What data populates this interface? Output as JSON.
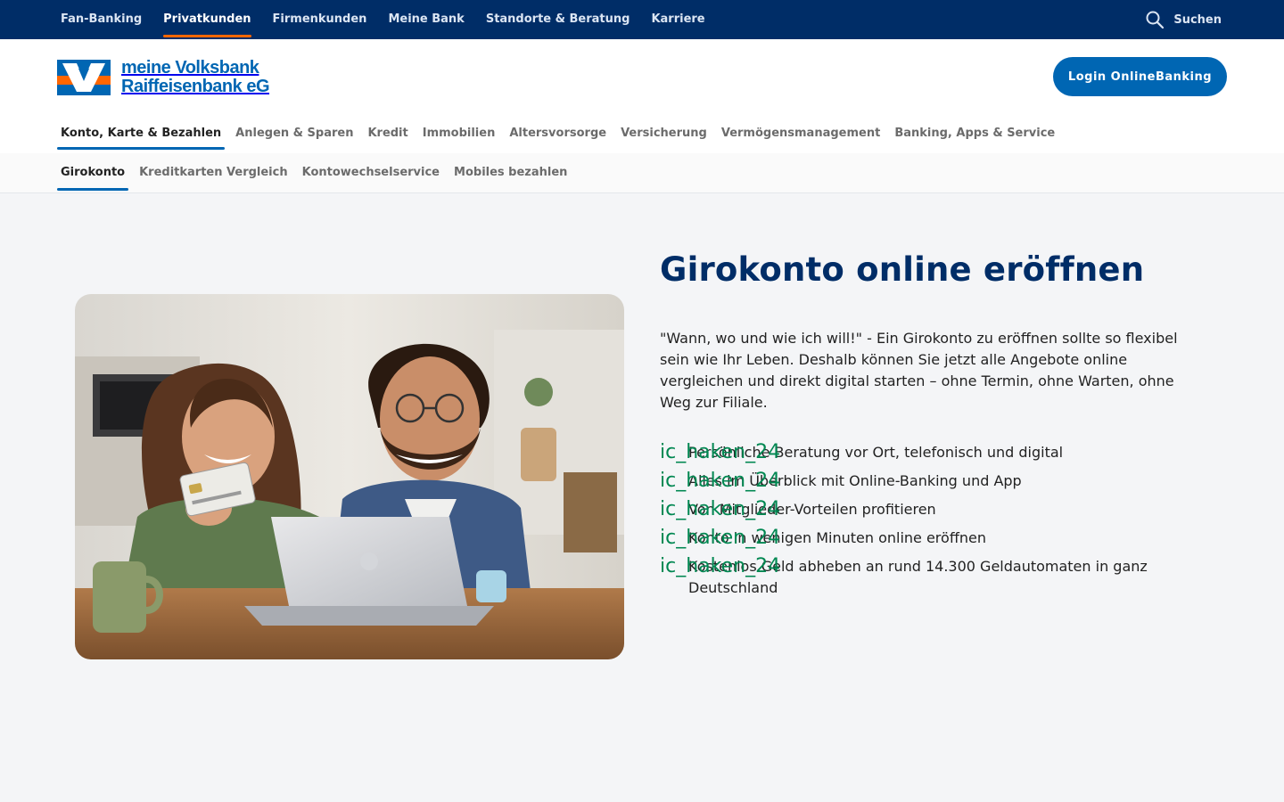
{
  "topbar": {
    "items": [
      {
        "label": "Fan-Banking"
      },
      {
        "label": "Privatkunden"
      },
      {
        "label": "Firmenkunden"
      },
      {
        "label": "Meine Bank"
      },
      {
        "label": "Standorte & Beratung"
      },
      {
        "label": "Karriere"
      }
    ],
    "active_item": "Privatkunden",
    "search_label": "Suchen"
  },
  "header": {
    "logo_line1": "meine Volksbank",
    "logo_line2": "Raiffeisenbank eG",
    "login_label": "Login OnlineBanking"
  },
  "mainnav": {
    "items": [
      {
        "label": "Konto, Karte & Bezahlen"
      },
      {
        "label": "Anlegen & Sparen"
      },
      {
        "label": "Kredit"
      },
      {
        "label": "Immobilien"
      },
      {
        "label": "Altersvorsorge"
      },
      {
        "label": "Versicherung"
      },
      {
        "label": "Vermögensmanagement"
      },
      {
        "label": "Banking, Apps & Service"
      }
    ],
    "active_item": "Konto, Karte & Bezahlen"
  },
  "subnav": {
    "items": [
      {
        "label": "Girokonto"
      },
      {
        "label": "Kreditkarten Vergleich"
      },
      {
        "label": "Kontowechselservice"
      },
      {
        "label": "Mobiles bezahlen"
      }
    ],
    "active_item": "Girokonto"
  },
  "hero": {
    "title": "Girokonto online eröffnen",
    "intro": "\"Wann, wo und wie ich will!\" - Ein Girokonto zu eröffnen sollte so flexibel sein wie Ihr Leben. Deshalb können Sie jetzt alle Angebote online vergleichen und direkt digital starten – ohne Termin, ohne Warten, ohne Weg zur Filiale.",
    "check_icon_text": "ic_haken_24",
    "benefits": [
      {
        "text": "Persönliche Beratung vor Ort, telefonisch und digital"
      },
      {
        "text": "Alles im Überblick mit Online-Banking und App"
      },
      {
        "text": "Von Mitglieder-Vorteilen profitieren"
      },
      {
        "text": "Konto in wenigen Minuten online eröffnen"
      },
      {
        "text": "Kostenlos Geld abheben an rund 14.300 Geldautomaten in ganz Deutschland"
      }
    ]
  },
  "colors": {
    "topbar_bg": "#002d67",
    "brand_blue": "#0066b3",
    "brand_orange": "#ff6600",
    "title_blue": "#002d67",
    "check_green": "#008751"
  }
}
